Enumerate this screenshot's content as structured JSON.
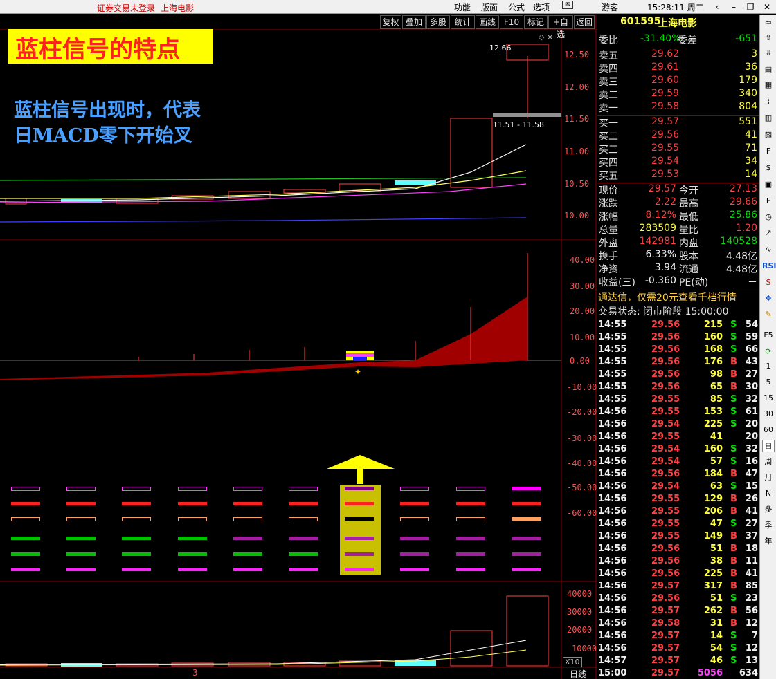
{
  "topbar": {
    "status": "证券交易未登录",
    "stock_name": "上海电影",
    "menu": [
      "功能",
      "版面",
      "公式",
      "选项"
    ],
    "mail_icon": "mail-icon",
    "guest": "游客",
    "clock": "15:28:11 周二"
  },
  "toolbar": [
    "复权",
    "叠加",
    "多股",
    "统计",
    "画线",
    "F10",
    "标记",
    "+自选",
    "返回"
  ],
  "banner": {
    "title": "蓝柱信号的特点",
    "line1": "蓝柱信号出现时，代表",
    "line2": "日MACD零下开始叉"
  },
  "chart_labels": {
    "high_label": "12.66",
    "range_label": "11.51 - 11.58",
    "x10": "X10",
    "period": "日线",
    "bottom_num": "3"
  },
  "price_axis": [
    "12.50",
    "12.00",
    "11.50",
    "11.00",
    "10.50",
    "10.00"
  ],
  "macd_axis": [
    "40.00",
    "30.00",
    "20.00",
    "10.00",
    "0.00",
    "-10.00",
    "-20.00",
    "-30.00",
    "-40.00",
    "-50.00",
    "-60.00"
  ],
  "vol_axis": [
    "40000",
    "30000",
    "20000",
    "10000"
  ],
  "quote": {
    "header": {
      "code": "601595",
      "name": "上海电影"
    },
    "weibi": {
      "label": "委比",
      "value": "-31.40%",
      "label2": "委差",
      "value2": "-651"
    },
    "sell": [
      {
        "label": "卖五",
        "price": "29.62",
        "vol": "3"
      },
      {
        "label": "卖四",
        "price": "29.61",
        "vol": "36"
      },
      {
        "label": "卖三",
        "price": "29.60",
        "vol": "179"
      },
      {
        "label": "卖二",
        "price": "29.59",
        "vol": "340"
      },
      {
        "label": "卖一",
        "price": "29.58",
        "vol": "804"
      }
    ],
    "buy": [
      {
        "label": "买一",
        "price": "29.57",
        "vol": "551"
      },
      {
        "label": "买二",
        "price": "29.56",
        "vol": "41"
      },
      {
        "label": "买三",
        "price": "29.55",
        "vol": "71"
      },
      {
        "label": "买四",
        "price": "29.54",
        "vol": "34"
      },
      {
        "label": "买五",
        "price": "29.53",
        "vol": "14"
      }
    ],
    "stats": [
      {
        "l1": "现价",
        "v1": "29.57",
        "l2": "今开",
        "v2": "27.13"
      },
      {
        "l1": "涨跌",
        "v1": "2.22",
        "l2": "最高",
        "v2": "29.66"
      },
      {
        "l1": "涨幅",
        "v1": "8.12%",
        "l2": "最低",
        "v2": "25.86"
      },
      {
        "l1": "总量",
        "v1": "283509",
        "l2": "量比",
        "v2": "1.20"
      },
      {
        "l1": "外盘",
        "v1": "142981",
        "l2": "内盘",
        "v2": "140528"
      },
      {
        "l1": "换手",
        "v1": "6.33%",
        "l2": "股本",
        "v2": "4.48亿"
      },
      {
        "l1": "净资",
        "v1": "3.94",
        "l2": "流通",
        "v2": "4.48亿"
      },
      {
        "l1": "收益(三)",
        "v1": "-0.360",
        "l2": "PE(动)",
        "v2": "－"
      }
    ],
    "notice": "通达信，仅需20元查看千档行情",
    "trade_status": "交易状态: 闭市阶段 15:00:00",
    "ticks": [
      [
        "14:55",
        "29.56",
        "215",
        "S",
        "54"
      ],
      [
        "14:55",
        "29.56",
        "160",
        "S",
        "59"
      ],
      [
        "14:55",
        "29.56",
        "168",
        "S",
        "66"
      ],
      [
        "14:55",
        "29.56",
        "176",
        "B",
        "43"
      ],
      [
        "14:55",
        "29.56",
        "98",
        "B",
        "27"
      ],
      [
        "14:55",
        "29.56",
        "65",
        "B",
        "30"
      ],
      [
        "14:55",
        "29.55",
        "85",
        "S",
        "32"
      ],
      [
        "14:56",
        "29.55",
        "153",
        "S",
        "61"
      ],
      [
        "14:56",
        "29.54",
        "225",
        "S",
        "20"
      ],
      [
        "14:56",
        "29.55",
        "41",
        "",
        "20"
      ],
      [
        "14:56",
        "29.54",
        "160",
        "S",
        "32"
      ],
      [
        "14:56",
        "29.54",
        "57",
        "S",
        "16"
      ],
      [
        "14:56",
        "29.56",
        "184",
        "B",
        "47"
      ],
      [
        "14:56",
        "29.54",
        "63",
        "S",
        "15"
      ],
      [
        "14:56",
        "29.55",
        "129",
        "B",
        "26"
      ],
      [
        "14:56",
        "29.55",
        "206",
        "B",
        "41"
      ],
      [
        "14:56",
        "29.55",
        "47",
        "S",
        "27"
      ],
      [
        "14:56",
        "29.55",
        "149",
        "B",
        "37"
      ],
      [
        "14:56",
        "29.56",
        "51",
        "B",
        "18"
      ],
      [
        "14:56",
        "29.56",
        "38",
        "B",
        "11"
      ],
      [
        "14:56",
        "29.56",
        "225",
        "B",
        "41"
      ],
      [
        "14:56",
        "29.57",
        "317",
        "B",
        "85"
      ],
      [
        "14:56",
        "29.56",
        "51",
        "S",
        "23"
      ],
      [
        "14:56",
        "29.57",
        "262",
        "B",
        "56"
      ],
      [
        "14:56",
        "29.58",
        "31",
        "B",
        "12"
      ],
      [
        "14:56",
        "29.57",
        "14",
        "S",
        "7"
      ],
      [
        "14:56",
        "29.57",
        "54",
        "S",
        "12"
      ],
      [
        "14:57",
        "29.57",
        "46",
        "S",
        "13"
      ],
      [
        "15:00",
        "29.57",
        "5056",
        "",
        "634"
      ]
    ]
  },
  "right_icons": [
    "1",
    "5",
    "15",
    "30",
    "60",
    "日",
    "周",
    "月",
    "N",
    "多",
    "季",
    "年"
  ]
}
